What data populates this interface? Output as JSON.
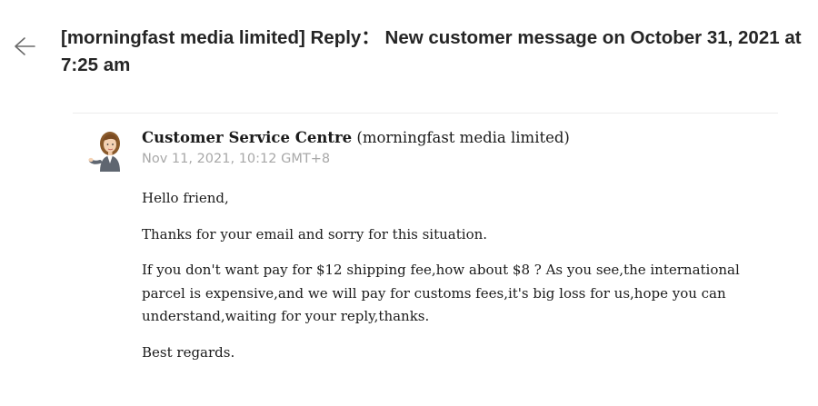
{
  "header": {
    "back_icon": "arrow-left-icon",
    "subject": "[morningfast media limited] Reply： New customer message on October 31, 2021 at 7:25 am"
  },
  "message": {
    "avatar_icon": "woman-avatar-icon",
    "sender_name": "Customer Service Centre",
    "sender_org": " (morningfast media limited)",
    "date": "Nov 11, 2021, 10:12 GMT+8",
    "body": [
      "Hello friend,",
      "Thanks for your email and sorry for this situation.",
      "If you don't want pay for $12 shipping fee,how about $8 ? As you see,the international parcel is expensive,and we will pay for customs fees,it's big loss for us,hope you can understand,waiting for your reply,thanks.",
      "Best regards."
    ]
  },
  "colors": {
    "subject": "#252525",
    "date": "#a8a8a8",
    "divider": "#ececec"
  }
}
